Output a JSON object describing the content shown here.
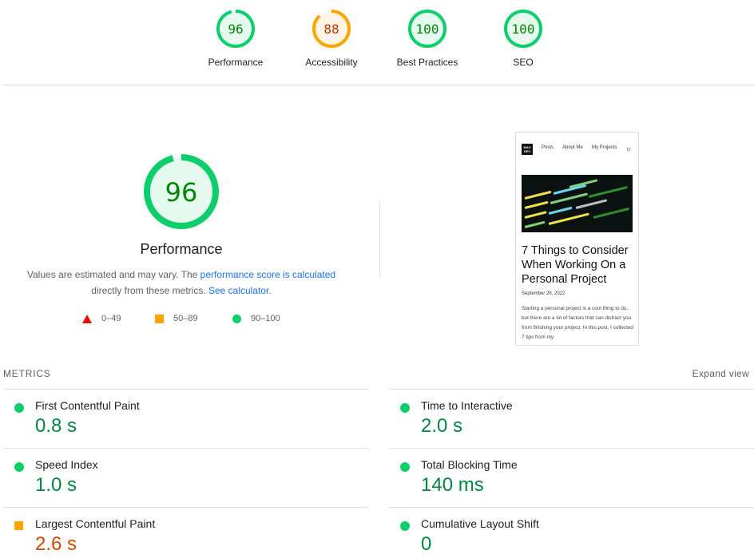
{
  "summary": [
    {
      "score": "96",
      "label": "Performance",
      "score_fraction": 0.96,
      "color": "#0cce6b",
      "text_color": "#008800",
      "bg": "#e6f9ef"
    },
    {
      "score": "88",
      "label": "Accessibility",
      "score_fraction": 0.88,
      "color": "#ffa400",
      "text_color": "#c33300",
      "bg": "#fff5e6"
    },
    {
      "score": "100",
      "label": "Best Practices",
      "score_fraction": 1.0,
      "color": "#0cce6b",
      "text_color": "#008800",
      "bg": "#e6f9ef"
    },
    {
      "score": "100",
      "label": "SEO",
      "score_fraction": 1.0,
      "color": "#0cce6b",
      "text_color": "#008800",
      "bg": "#e6f9ef"
    }
  ],
  "performance": {
    "score": "96",
    "score_fraction": 0.96,
    "title": "Performance",
    "desc_part1": "Values are estimated and may vary. The ",
    "desc_link1": "performance score is calculated",
    "desc_part2": "directly from these metrics. ",
    "desc_link2": "See calculator."
  },
  "legend": {
    "fail": "0–49",
    "average": "50–89",
    "pass": "90–100"
  },
  "thumbnail": {
    "logo_top": "MAX",
    "logo_bottom": "DEV",
    "nav": [
      "Posts",
      "About Me",
      "My Projects"
    ],
    "theme_icon": "sun-icon",
    "post_title": "7 Things to Consider When Working On a Personal Project",
    "post_date": "September 26, 2022",
    "post_body": "Starting a personal project is a cool thing to do, but there are a lot of factors that can distract you from finishing your project. In this post, I collected 7 tips from my"
  },
  "metrics": {
    "heading": "METRICS",
    "expand_label": "Expand view",
    "items": [
      {
        "title": "First Contentful Paint",
        "value": "0.8 s",
        "status": "pass"
      },
      {
        "title": "Time to Interactive",
        "value": "2.0 s",
        "status": "pass"
      },
      {
        "title": "Speed Index",
        "value": "1.0 s",
        "status": "pass"
      },
      {
        "title": "Total Blocking Time",
        "value": "140 ms",
        "status": "pass"
      },
      {
        "title": "Largest Contentful Paint",
        "value": "2.6 s",
        "status": "average"
      },
      {
        "title": "Cumulative Layout Shift",
        "value": "0",
        "status": "pass"
      }
    ]
  },
  "colors": {
    "pass": "#0cce6b",
    "average": "#ffa400",
    "fail": "#eb0f00",
    "pass_text": "#018642",
    "average_text": "#d04900",
    "link": "#1a73e8"
  }
}
